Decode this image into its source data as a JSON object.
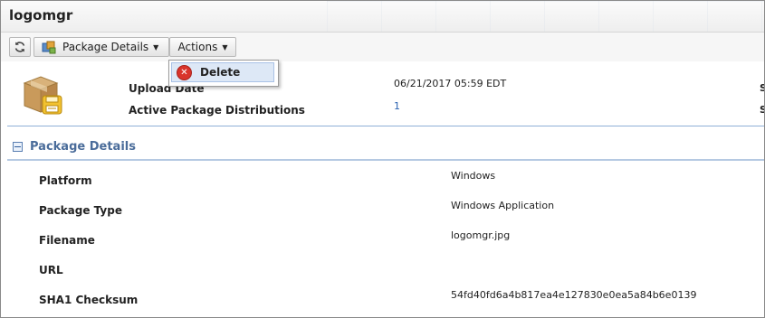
{
  "window": {
    "title": "logomgr"
  },
  "toolbar": {
    "refresh_icon": "refresh-icon",
    "package_details_label": "Package Details",
    "actions_label": "Actions"
  },
  "actions_menu": {
    "items": [
      {
        "label": "Delete",
        "icon": "delete-icon",
        "color": "#d9342b"
      }
    ]
  },
  "summary": {
    "icon": "package-box-icon",
    "upload_date_label": "Upload Date",
    "upload_date_value": "06/21/2017 05:59 EDT",
    "active_dist_label": "Active Package Distributions",
    "active_dist_value": "1",
    "edge_letter_1": "S",
    "edge_letter_2": "S"
  },
  "details": {
    "section_title": "Package Details",
    "rows": [
      {
        "label": "Platform",
        "value": "Windows"
      },
      {
        "label": "Package Type",
        "value": "Windows Application"
      },
      {
        "label": "Filename",
        "value": "logomgr.jpg"
      },
      {
        "label": "URL",
        "value": ""
      },
      {
        "label": "SHA1 Checksum",
        "value": "54fd40fd6a4b817ea4e127830e0ea5a84b6e0139"
      }
    ]
  },
  "colors": {
    "accent": "#4a6c9a",
    "link": "#2a62b0",
    "menu_highlight": "#dde8f6"
  }
}
